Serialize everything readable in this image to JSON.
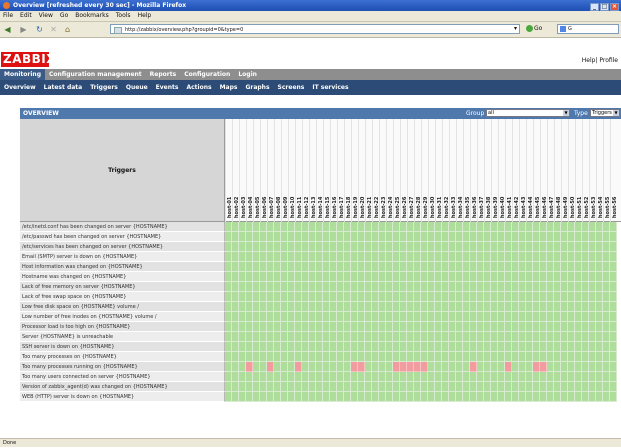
{
  "window": {
    "title": "Overview [refreshed every 30 sec] - Mozilla Firefox"
  },
  "browser_menu": [
    "File",
    "Edit",
    "View",
    "Go",
    "Bookmarks",
    "Tools",
    "Help"
  ],
  "address_bar": {
    "url": "http://zabbix/overview.php?groupid=0&type=0",
    "go_label": "Go",
    "search_value": "G"
  },
  "zabbix": {
    "logo": "ZABBIX",
    "help_profile": "Help| Profile",
    "main_menu": [
      {
        "label": "Monitoring",
        "active": true
      },
      {
        "label": "Configuration management",
        "active": false
      },
      {
        "label": "Reports",
        "active": false
      },
      {
        "label": "Configuration",
        "active": false
      },
      {
        "label": "Login",
        "active": false
      }
    ],
    "sub_menu": [
      "Overview",
      "Latest data",
      "Triggers",
      "Queue",
      "Events",
      "Actions",
      "Maps",
      "Graphs",
      "Screens",
      "IT services"
    ]
  },
  "overview": {
    "title": "OVERVIEW",
    "group_label": "Group",
    "group_value": "all",
    "type_label": "Type",
    "type_value": "Triggers",
    "triggers_header": "Triggers",
    "hosts": [
      "host-01",
      "host-02",
      "host-03",
      "host-04",
      "host-05",
      "host-06",
      "host-07",
      "host-08",
      "host-09",
      "host-10",
      "host-11",
      "host-12",
      "host-13",
      "host-14",
      "host-15",
      "host-16",
      "host-17",
      "host-18",
      "host-19",
      "host-20",
      "host-21",
      "host-22",
      "host-23",
      "host-24",
      "host-25",
      "host-26",
      "host-27",
      "host-28",
      "host-29",
      "host-30",
      "host-31",
      "host-32",
      "host-33",
      "host-34",
      "host-35",
      "host-36",
      "host-37",
      "host-38",
      "host-39",
      "host-40",
      "host-41",
      "host-42",
      "host-43",
      "host-44",
      "host-45",
      "host-46",
      "host-47",
      "host-48",
      "host-49",
      "host-50",
      "host-51",
      "host-52",
      "host-53",
      "host-54",
      "host-55",
      "host-56"
    ],
    "triggers": [
      {
        "name": "/etc/inetd.conf has been changed on server {HOSTNAME}",
        "problems": []
      },
      {
        "name": "/etc/passwd has been changed on server {HOSTNAME}",
        "problems": []
      },
      {
        "name": "/etc/services has been changed on server {HOSTNAME}",
        "problems": []
      },
      {
        "name": "Email (SMTP) server is down on {HOSTNAME}",
        "problems": []
      },
      {
        "name": "Host information was changed on {HOSTNAME}",
        "problems": []
      },
      {
        "name": "Hostname was changed on {HOSTNAME}",
        "problems": []
      },
      {
        "name": "Lack of free memory on server {HOSTNAME}",
        "problems": []
      },
      {
        "name": "Lack of free swap space on {HOSTNAME}",
        "problems": []
      },
      {
        "name": "Low free disk space on {HOSTNAME} volume /",
        "problems": []
      },
      {
        "name": "Low number of free inodes on {HOSTNAME} volume /",
        "problems": []
      },
      {
        "name": "Processor load is too high on {HOSTNAME}",
        "problems": []
      },
      {
        "name": "Server {HOSTNAME} is unreachable",
        "problems": []
      },
      {
        "name": "SSH server is down on {HOSTNAME}",
        "problems": []
      },
      {
        "name": "Too many processes on {HOSTNAME}",
        "problems": []
      },
      {
        "name": "Too many processes running on {HOSTNAME}",
        "problems": [
          3,
          6,
          10,
          18,
          19,
          24,
          25,
          26,
          27,
          28,
          35,
          40,
          44,
          45
        ]
      },
      {
        "name": "Too many users connected on server {HOSTNAME}",
        "problems": []
      },
      {
        "name": "Version of zabbix_agent(d) was changed on {HOSTNAME}",
        "problems": []
      },
      {
        "name": "WEB (HTTP) server is down on {HOSTNAME}",
        "problems": []
      }
    ]
  },
  "status_bar": "Done",
  "colors": {
    "ok": "#aedd9c",
    "problem": "#f29ca0",
    "header_blue": "#2c4b77",
    "logo_red": "#d11111"
  }
}
